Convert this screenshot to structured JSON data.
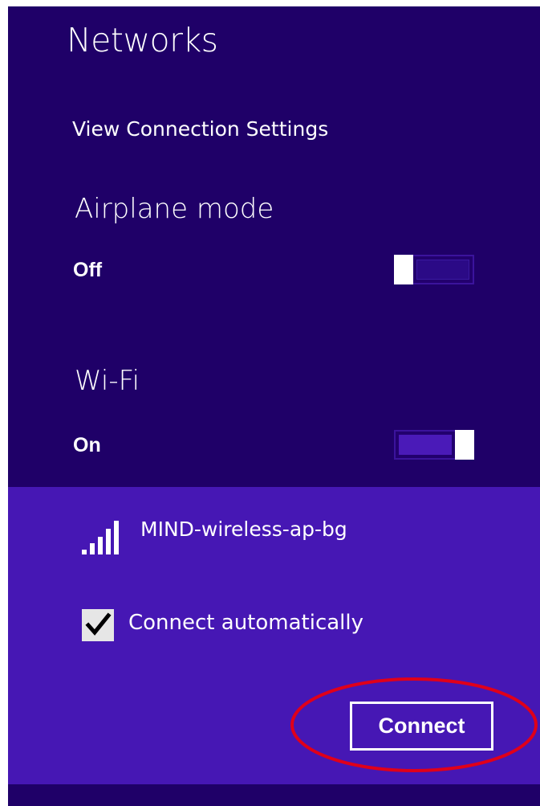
{
  "panel": {
    "title": "Networks",
    "view_settings_link": "View Connection Settings"
  },
  "airplane_mode": {
    "heading": "Airplane mode",
    "state_label": "Off",
    "enabled": false
  },
  "wifi": {
    "heading": "Wi-Fi",
    "state_label": "On",
    "enabled": true
  },
  "network": {
    "name": "MIND-wireless-ap-bg",
    "signal_icon": "wifi-signal-bars-icon",
    "signal_bars": 5,
    "connect_automatically_label": "Connect automatically",
    "connect_automatically_checked": true,
    "connect_button_label": "Connect"
  },
  "colors": {
    "background": "#1f0068",
    "selected_item": "#4617b4",
    "highlight_annotation": "#e0001a"
  }
}
